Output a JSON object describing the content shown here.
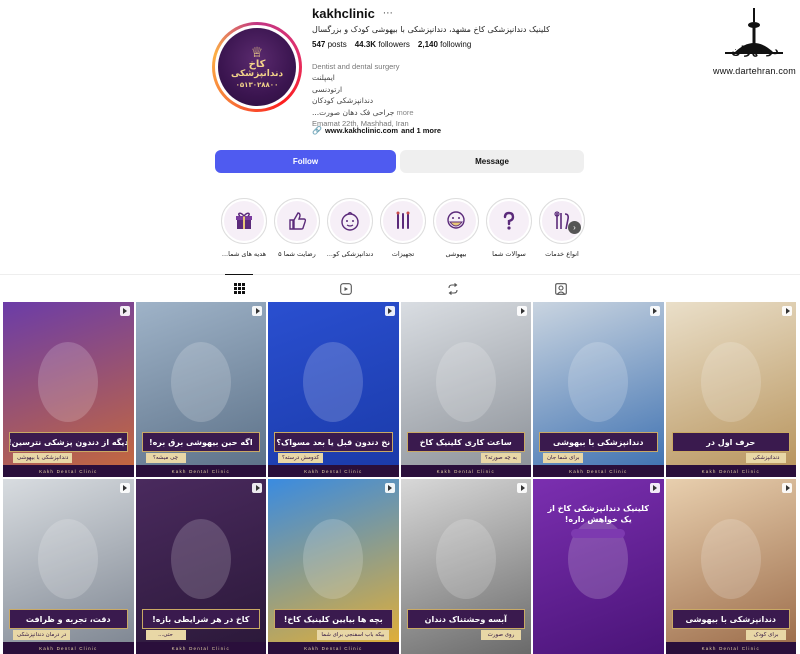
{
  "watermark": {
    "logo_text": "در تهران",
    "url": "www.dartehran.com"
  },
  "profile": {
    "username": "kakhclinic",
    "more_icon": "ellipsis-icon",
    "full_name": "کلینیک دندانپزشکی کاخ مشهد، دندانپزشکی با بیهوشی کودک و بزرگسال",
    "avatar": {
      "name": "کاخ",
      "subtitle": "دندانپزشکی",
      "phone": "۰۵۱۳۰۲۸۸۰۰"
    },
    "stats": {
      "posts_count": "547",
      "posts_label": "posts",
      "followers_count": "44.3K",
      "followers_label": "followers",
      "following_count": "2,140",
      "following_label": "following"
    },
    "bio": {
      "category": "Dentist and dental surgery",
      "lines": [
        "ایمپلنت",
        "ارتودنسی",
        "دندانپزشکی کودکان"
      ],
      "truncated_line": "...جراحی فک دهان صورت",
      "more": "more",
      "location": "Emamat 22th, Mashhad, Iran"
    },
    "links": {
      "primary": "www.kakhclinic.com",
      "suffix": "and 1 more"
    },
    "buttons": {
      "follow": "Follow",
      "message": "Message"
    }
  },
  "highlights": [
    {
      "label": "هدیه های شما...",
      "icon": "gift-icon"
    },
    {
      "label": "رضایت شما ۵",
      "icon": "thumbs-up-icon"
    },
    {
      "label": "دندانپزشکی کو...",
      "icon": "child-face-icon"
    },
    {
      "label": "تجهیزات",
      "icon": "dental-tools-icon"
    },
    {
      "label": "بیهوشی",
      "icon": "mask-face-icon"
    },
    {
      "label": "سوالات شما",
      "icon": "question-icon"
    },
    {
      "label": "انواع خدمات",
      "icon": "tools-icon"
    }
  ],
  "tabs": [
    {
      "name": "posts",
      "icon": "grid-icon",
      "active": true
    },
    {
      "name": "reels",
      "icon": "reels-icon",
      "active": false
    },
    {
      "name": "reposts",
      "icon": "repost-icon",
      "active": false
    },
    {
      "name": "tagged",
      "icon": "tagged-icon",
      "active": false
    }
  ],
  "posts": [
    {
      "title": "دیگه از دندون پزشکی نترسین!",
      "tag": "دندانپزشکی با بیهوشی",
      "footer": "Kakh Dental Clinic",
      "tag_side": "l",
      "colors": [
        "#6b3ca8",
        "#c76a3a"
      ]
    },
    {
      "title": "اگه حین بیهوشی برق بره!",
      "tag": "چی میشه؟",
      "footer": "Kakh Dental Clinic",
      "tag_side": "l",
      "colors": [
        "#9fb3c8",
        "#5a6f86"
      ]
    },
    {
      "title": "نخ دندون قبل یا بعد مسواک؟",
      "tag": "کدومش درسته؟",
      "footer": "Kakh Dental Clinic",
      "tag_side": "l",
      "colors": [
        "#2a4fd0",
        "#1a3aa8"
      ]
    },
    {
      "title": "ساعت کاری کلینیک کاخ",
      "tag": "به چه صورته؟",
      "footer": "Kakh Dental Clinic",
      "tag_side": "r",
      "colors": [
        "#d9dde2",
        "#8a8f96"
      ]
    },
    {
      "title": "دندانپزشکی با بیهوشی",
      "tag": "برای شما جان",
      "footer": "Kakh Dental Clinic",
      "tag_side": "l",
      "colors": [
        "#c9d4e0",
        "#3b6fb0"
      ]
    },
    {
      "title": "حرف اول در",
      "tag": "دندانپزشکی",
      "footer": "Kakh Dental Clinic",
      "tag_side": "r",
      "colors": [
        "#eadfc9",
        "#b6925a"
      ]
    },
    {
      "title": "دقت، تجربه و ظرافت",
      "tag": "در درمان دندانپزشکی",
      "footer": "Kakh Dental Clinic",
      "tag_side": "l",
      "colors": [
        "#d8dce0",
        "#7c8490"
      ]
    },
    {
      "title": "کاخ در هر شرایطی بازه!",
      "tag": "حتی...",
      "footer": "Kakh Dental Clinic",
      "tag_side": "l",
      "colors": [
        "#4a2a5e",
        "#2a1838"
      ]
    },
    {
      "title": "بچه ها بیایین کلینیک کاخ!",
      "tag": "بیکه باب اسفنجی برای شما",
      "footer": "Kakh Dental Clinic",
      "tag_side": "r",
      "colors": [
        "#3a8be0",
        "#e8b030"
      ]
    },
    {
      "title": "آبسه وحشتناک دندان",
      "tag": "روی صورت",
      "footer": "",
      "tag_side": "r",
      "colors": [
        "#d8d8d8",
        "#6a6a6a"
      ]
    },
    {
      "title": "",
      "tag": "",
      "footer": "",
      "tag_side": "r",
      "colors": [
        "#7b2fb0",
        "#4a1478"
      ],
      "promo": "کلینیک دندانپزشکی کاخ از یک خواهش داره!"
    },
    {
      "title": "دندانپزشکی با بیهوشی",
      "tag": "برای کودک",
      "footer": "Kakh Dental Clinic",
      "tag_side": "r",
      "colors": [
        "#e8cfae",
        "#9a6a48"
      ]
    }
  ]
}
